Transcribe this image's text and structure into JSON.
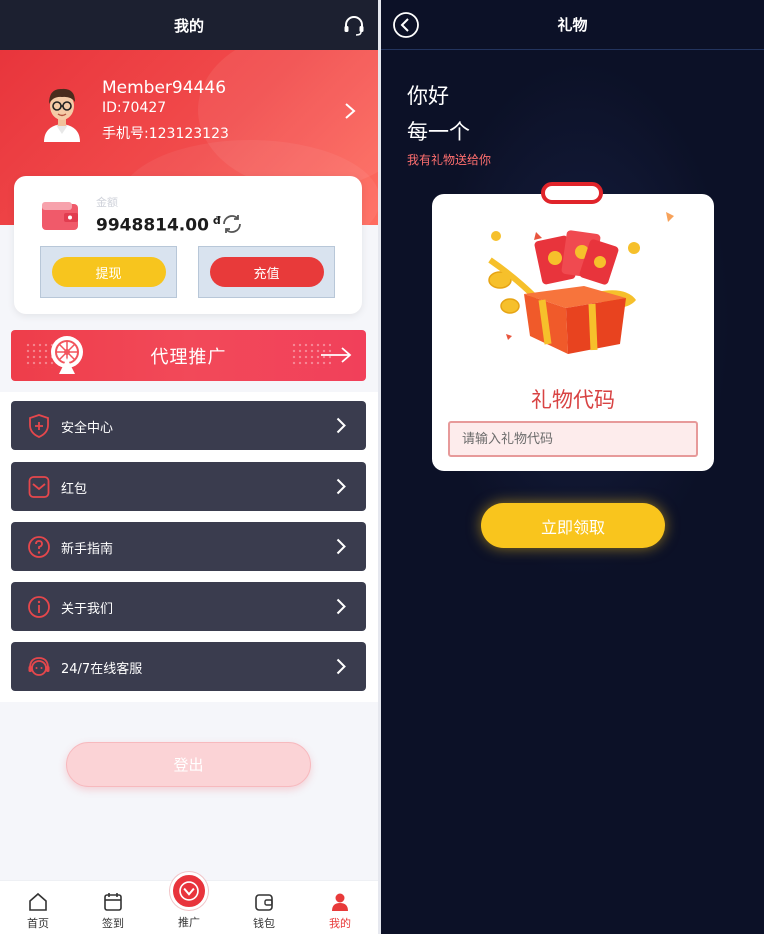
{
  "profile_screen": {
    "header": {
      "title": "我的",
      "support_icon": "headset-icon"
    },
    "user": {
      "name": "Member94446",
      "id_text": "ID:70427",
      "phone_text": "手机号:123123123"
    },
    "wallet": {
      "balance_label": "金额",
      "balance_value": "9948814.00",
      "currency": "đ",
      "withdraw_label": "提现",
      "recharge_label": "充值"
    },
    "agent_banner": {
      "label": "代理推广"
    },
    "menu": [
      {
        "label": "安全中心",
        "icon": "shield-icon"
      },
      {
        "label": "红包",
        "icon": "red-envelope-icon"
      },
      {
        "label": "新手指南",
        "icon": "question-icon"
      },
      {
        "label": "关于我们",
        "icon": "info-icon"
      },
      {
        "label": "24/7在线客服",
        "icon": "customer-service-icon"
      }
    ],
    "logout_label": "登出",
    "tabbar": [
      {
        "label": "首页",
        "icon": "home-icon"
      },
      {
        "label": "签到",
        "icon": "calendar-icon"
      },
      {
        "label": "推广",
        "icon": "promote-icon"
      },
      {
        "label": "钱包",
        "icon": "wallet-icon"
      },
      {
        "label": "我的",
        "icon": "user-icon",
        "active": true
      }
    ]
  },
  "gift_screen": {
    "header": {
      "title": "礼物"
    },
    "greeting": "你好",
    "greeting_line2": "每一个",
    "subtitle": "我有礼物送给你",
    "card_title": "礼物代码",
    "input_placeholder": "请输入礼物代码",
    "claim_label": "立即领取"
  },
  "colors": {
    "primary_red": "#e83a3a",
    "accent_yellow": "#f7c51e",
    "dark_bg": "#0c1127",
    "menu_bg": "#3a3c4e"
  }
}
